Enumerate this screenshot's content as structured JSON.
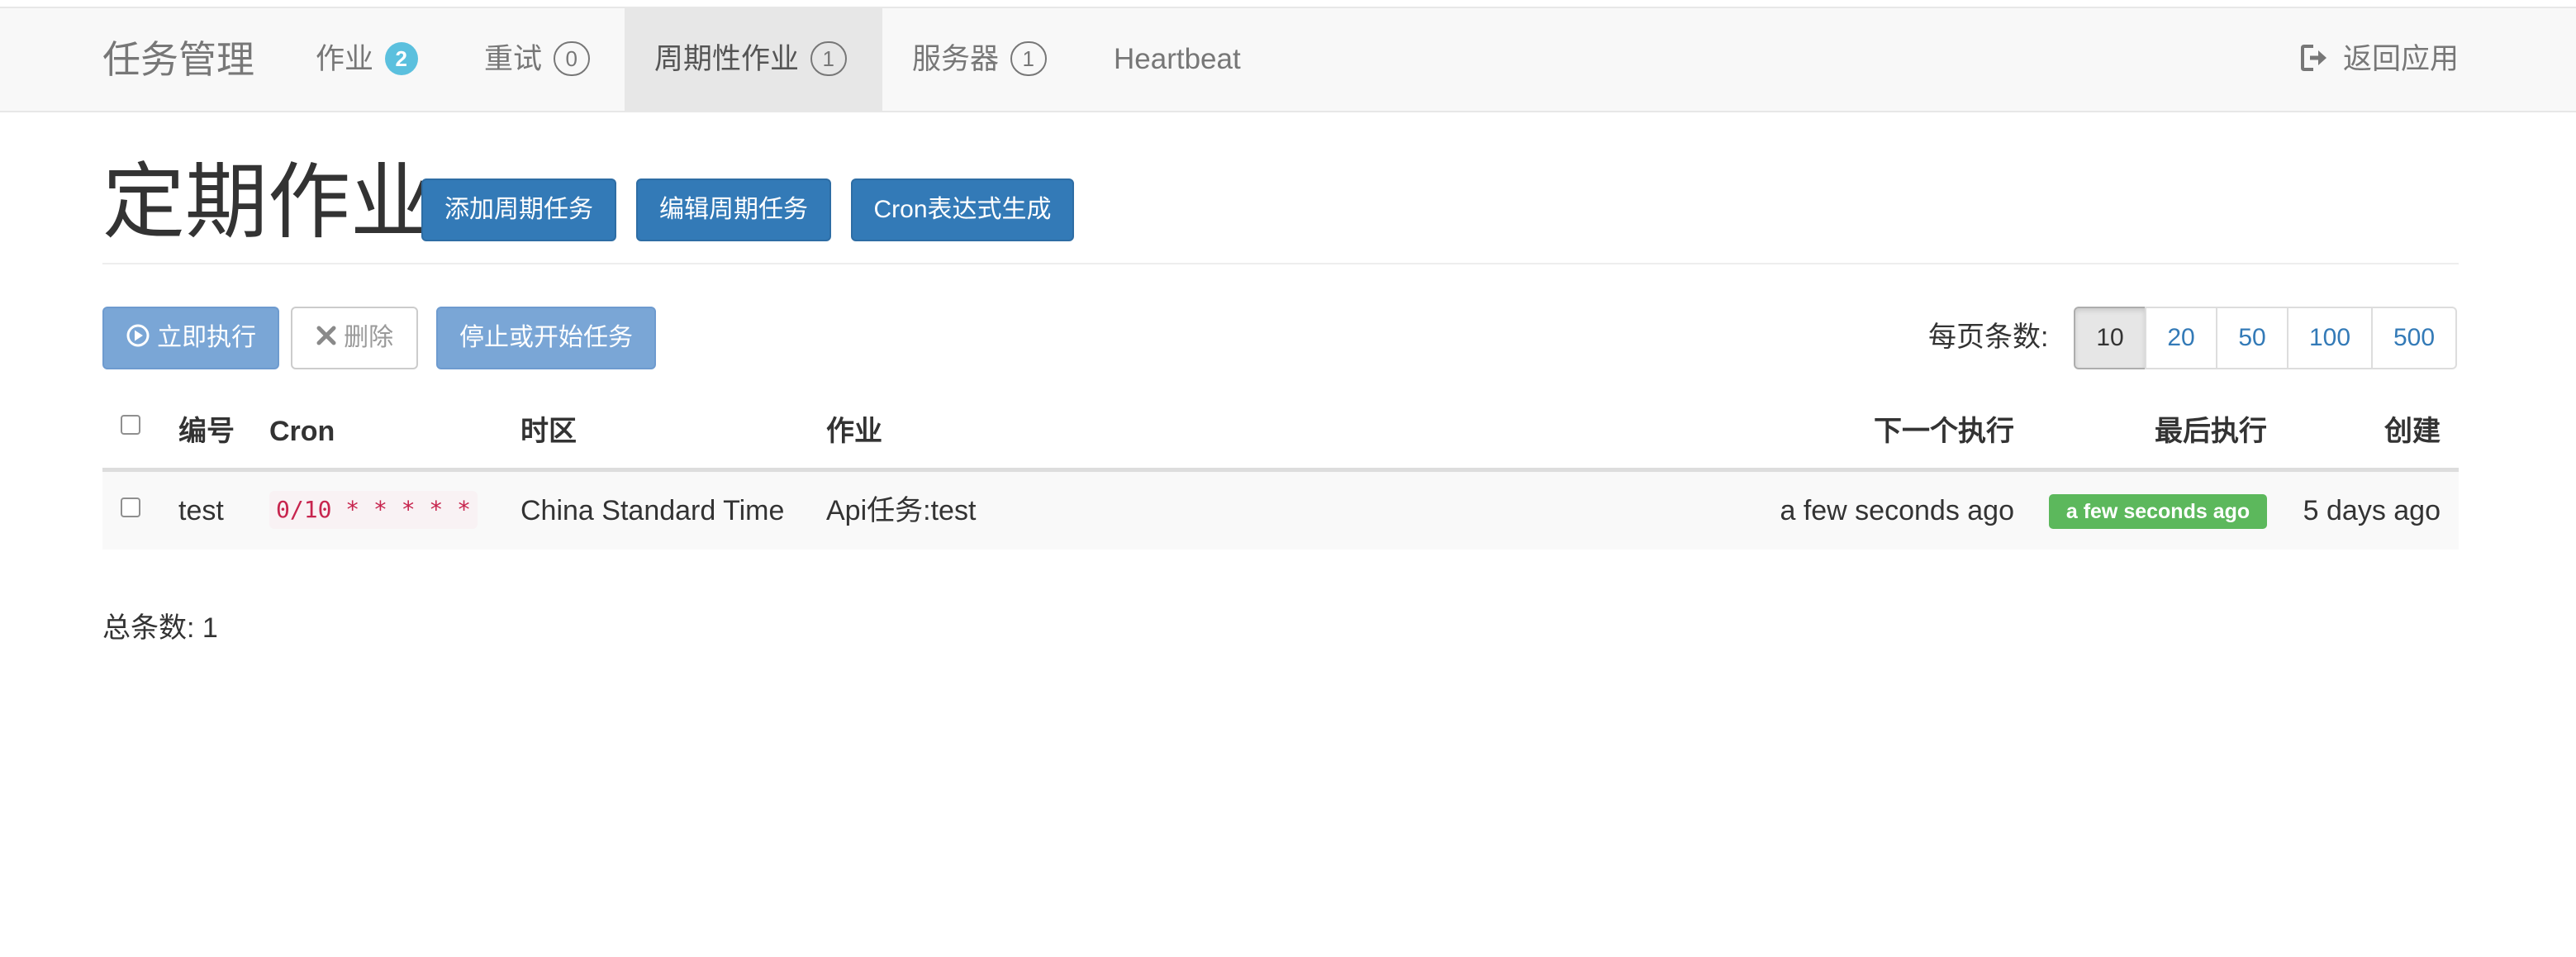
{
  "navbar": {
    "brand": "任务管理",
    "items": [
      {
        "label": "作业",
        "badge": "2"
      },
      {
        "label": "重试",
        "badge": "0"
      },
      {
        "label": "周期性作业",
        "badge": "1"
      },
      {
        "label": "服务器",
        "badge": "1"
      },
      {
        "label": "Heartbeat"
      }
    ],
    "active_item": "周期性作业",
    "return_label": "返回应用",
    "return_icon": "sign-out-icon"
  },
  "page": {
    "title": "定期作业",
    "header_buttons": {
      "add": "添加周期任务",
      "edit": "编辑周期任务",
      "cron": "Cron表达式生成"
    }
  },
  "toolbar": {
    "execute_label": "立即执行",
    "execute_icon": "play-circle-icon",
    "delete_label": "删除",
    "delete_icon": "close-icon",
    "toggle_label": "停止或开始任务",
    "per_page_label": "每页条数:",
    "per_page_options": [
      "10",
      "20",
      "50",
      "100",
      "500"
    ],
    "per_page_selected": "10"
  },
  "table": {
    "columns": [
      "编号",
      "Cron",
      "时区",
      "作业",
      "下一个执行",
      "最后执行",
      "创建"
    ],
    "rows": [
      {
        "id": "test",
        "cron": "0/10 * * * * *",
        "timezone": "China Standard Time",
        "job": "Api任务:test",
        "next": "a few seconds ago",
        "last": "a few seconds ago",
        "created": "5 days ago"
      }
    ]
  },
  "footer": {
    "total_label": "总条数: 1"
  },
  "colors": {
    "primary": "#337ab7",
    "info_badge": "#5bc0de",
    "success": "#5cb85c",
    "code_text": "#c7254e"
  }
}
